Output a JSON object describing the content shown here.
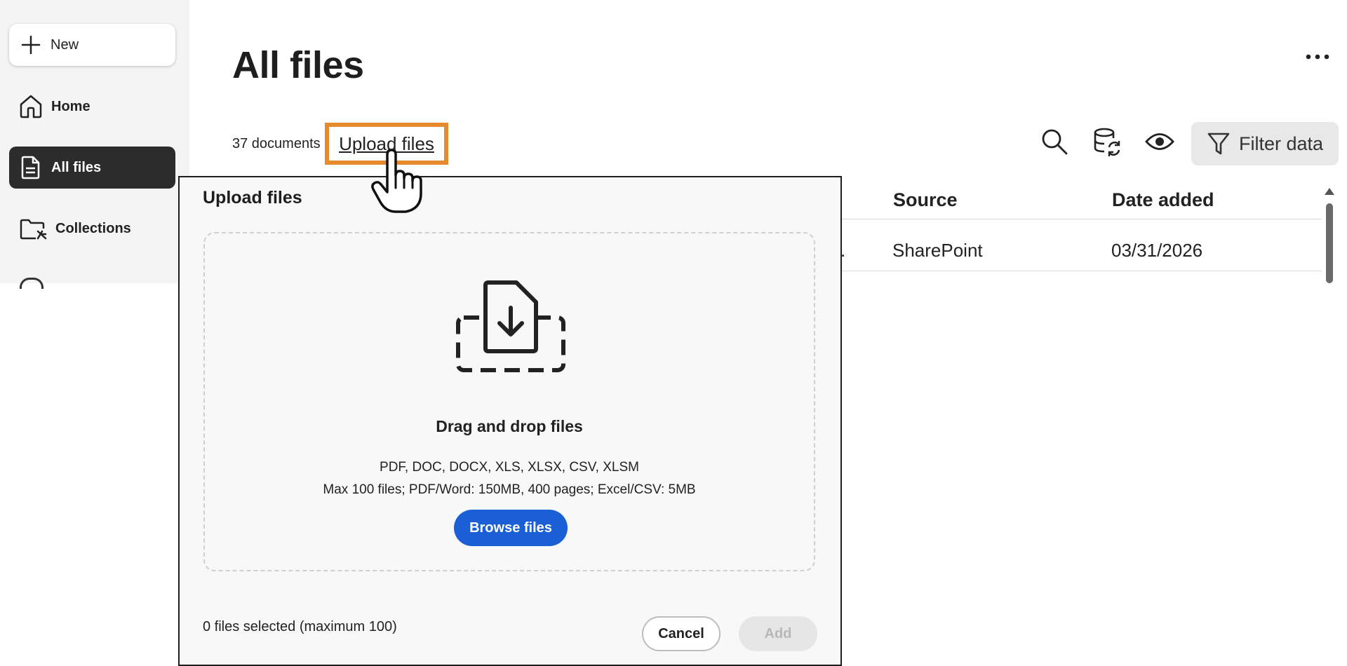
{
  "sidebar": {
    "new_label": "New",
    "items": [
      {
        "label": "Home",
        "icon": "home-icon",
        "active": false
      },
      {
        "label": "All files",
        "icon": "document-icon",
        "active": true
      },
      {
        "label": "Collections",
        "icon": "folder-collection-icon",
        "active": false
      }
    ]
  },
  "main": {
    "title": "All files",
    "more_icon": "more-horizontal-icon",
    "doc_count": "37 documents",
    "upload_link": "Upload files",
    "toolbar": {
      "icons": [
        "search-icon",
        "database-sync-icon",
        "eye-icon"
      ],
      "filter_label": "Filter data",
      "filter_icon": "filter-icon"
    },
    "table": {
      "headers": [
        "Source",
        "Date added"
      ],
      "rows": [
        {
          "truncated": ".",
          "source": "SharePoint",
          "date_added": "03/31/2026"
        }
      ]
    }
  },
  "dialog": {
    "title": "Upload files",
    "dropzone": {
      "icon": "file-download-icon",
      "title": "Drag and drop files",
      "types": "PDF, DOC, DOCX, XLS, XLSX, CSV, XLSM",
      "limits": "Max 100 files; PDF/Word: 150MB, 400 pages; Excel/CSV: 5MB",
      "browse_label": "Browse files"
    },
    "selected_info": "0 files selected (maximum 100)",
    "cancel_label": "Cancel",
    "add_label": "Add"
  },
  "colors": {
    "accent_blue": "#1a5fd6",
    "highlight_orange": "#e68a2e",
    "active_nav": "#2c2c2c"
  }
}
